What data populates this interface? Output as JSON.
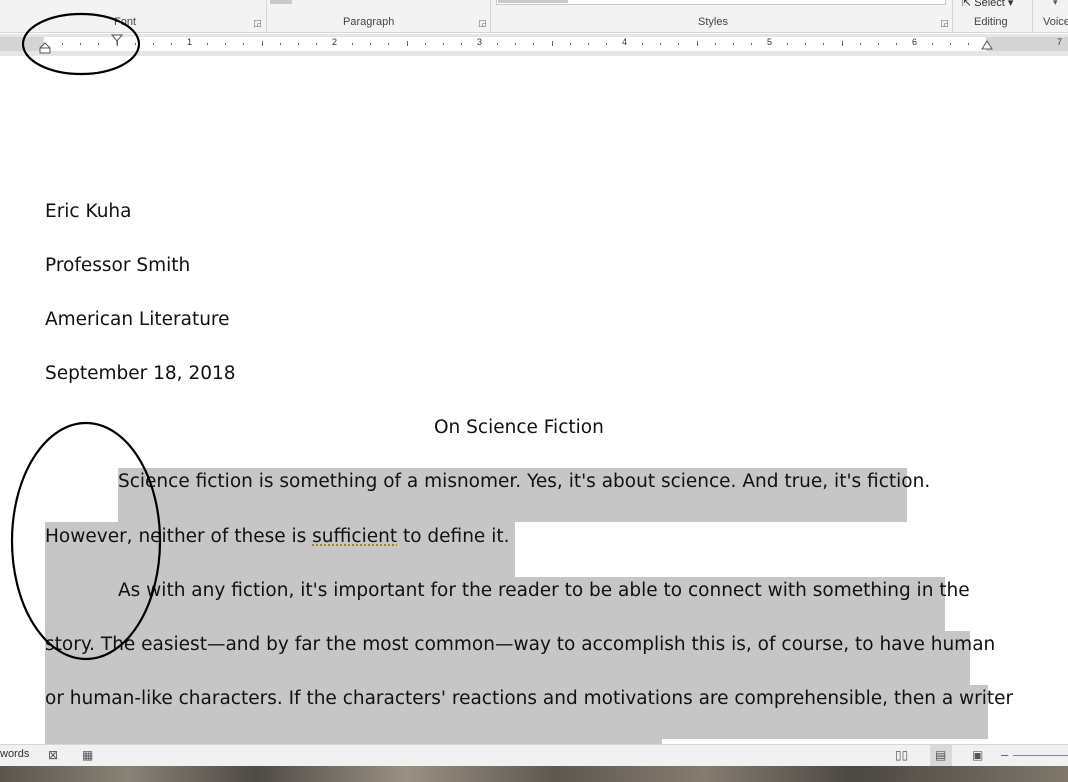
{
  "ribbon": {
    "groups": {
      "font": "Font",
      "paragraph": "Paragraph",
      "styles": "Styles",
      "editing": "Editing",
      "voice": "Voice"
    },
    "select_label": "Select ▾",
    "launcher_glyph": "◲"
  },
  "ruler": {
    "numbers": [
      "1",
      "2",
      "3",
      "4",
      "5",
      "6",
      "7"
    ]
  },
  "document": {
    "author": "Eric Kuha",
    "professor": "Professor Smith",
    "course": "American Literature",
    "date": "September 18, 2018",
    "title": "On Science Fiction",
    "p1_l1": "Science fiction is something of a misnomer. Yes, it's about science. And true, it's fiction.",
    "p1_l2_before": "However, neither of these is ",
    "p1_l2_flagged": "sufficient",
    "p1_l2_after": " to define it.",
    "p2_l1": "As with any fiction, it's important for the reader to be able to connect with something in the",
    "p2_l2": "story. The easiest—and by far the most common—way to accomplish this is, of course, to have human",
    "p2_l3": "or human-like characters. If the characters' reactions and motivations are comprehensible, then a writer"
  },
  "status_bar": {
    "words": "words"
  },
  "icons": [
    "proofing-icon",
    "macro-icon",
    "read-mode-icon",
    "print-layout-icon",
    "web-layout-icon",
    "zoom-out-icon",
    "first-line-indent-icon",
    "hanging-indent-icon",
    "right-indent-icon"
  ],
  "colors": {
    "selection": "#c6c6c6",
    "annotation_stroke": "#000000",
    "spelling_underline": "#b07a00"
  }
}
